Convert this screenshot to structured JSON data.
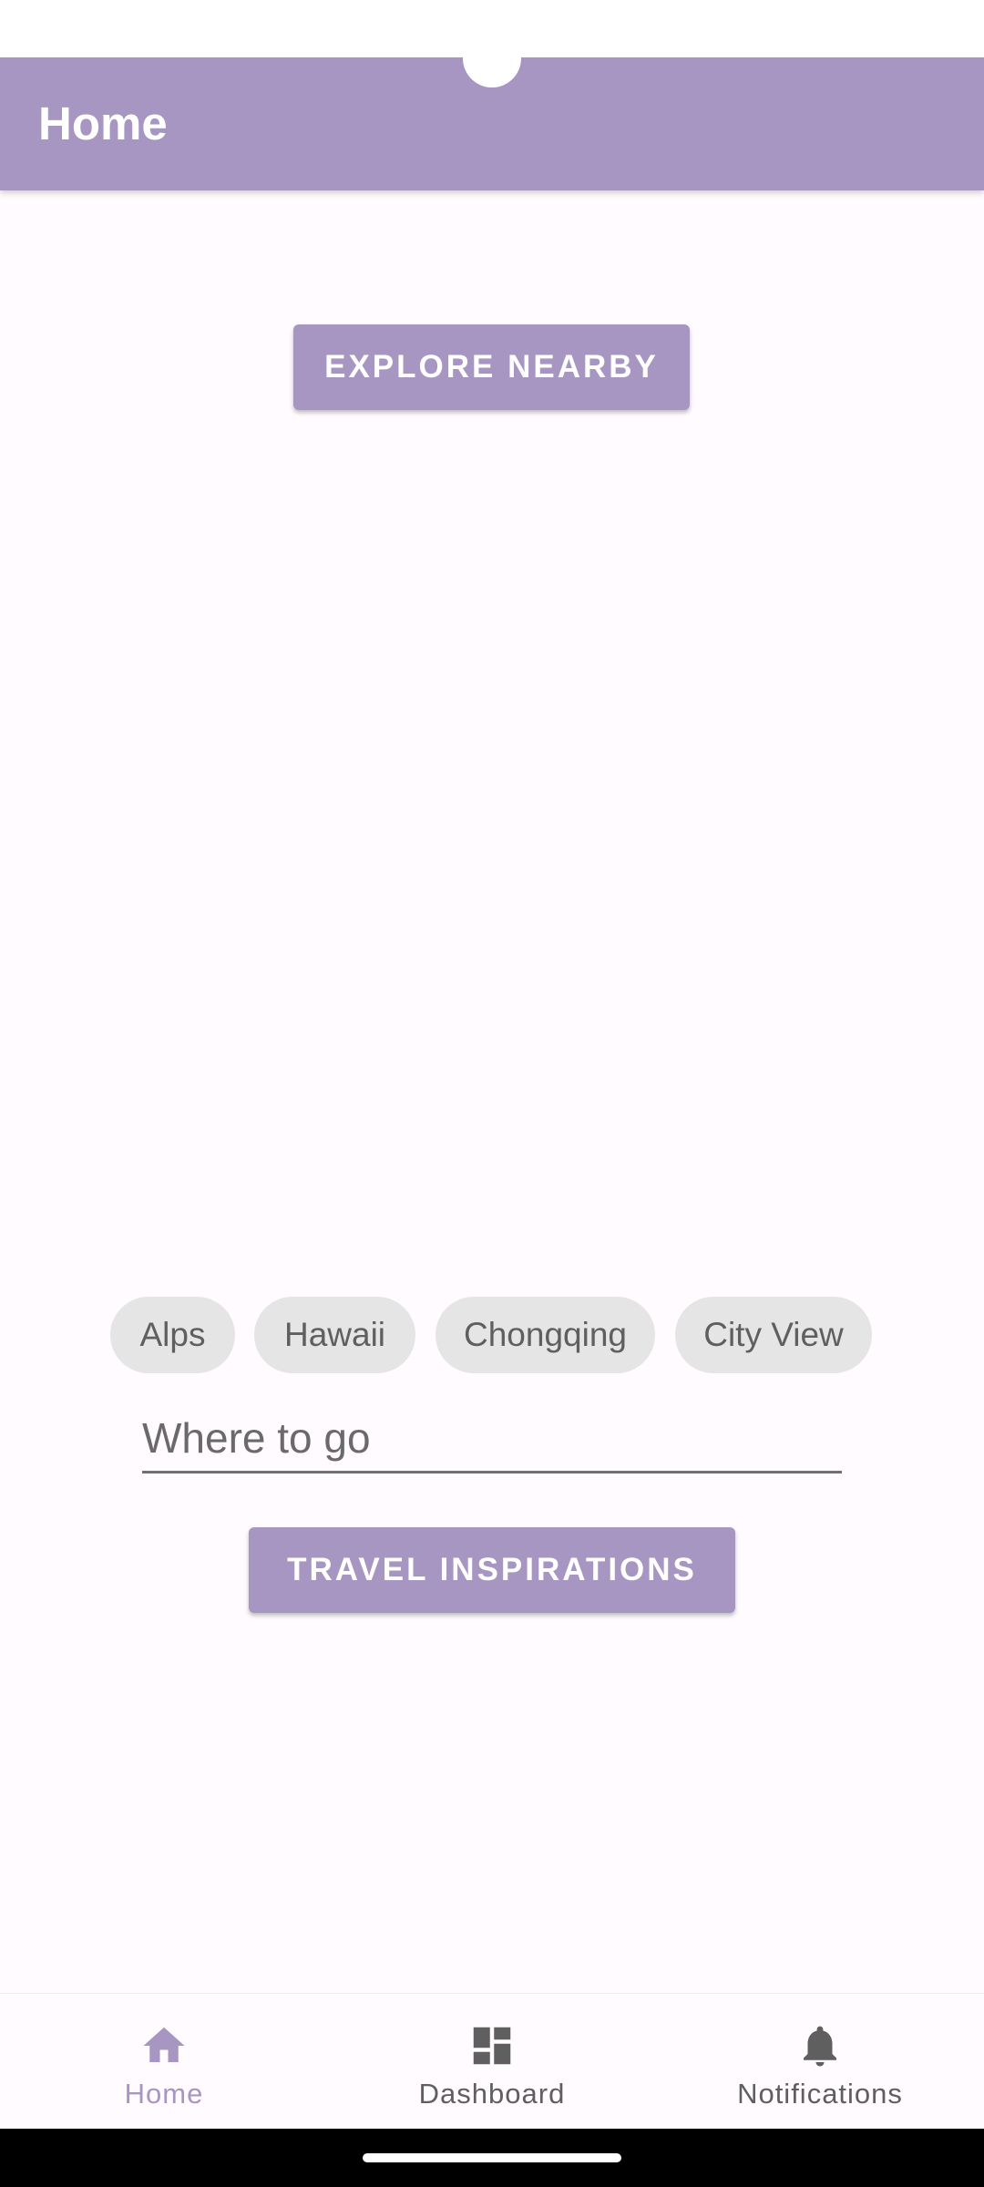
{
  "app_bar": {
    "title": "Home"
  },
  "main": {
    "explore_button_label": "EXPLORE NEARBY",
    "chips": [
      {
        "label": "Alps"
      },
      {
        "label": "Hawaii"
      },
      {
        "label": "Chongqing"
      },
      {
        "label": "City View"
      }
    ],
    "destination_input": {
      "placeholder": "Where to go",
      "value": ""
    },
    "travel_button_label": "TRAVEL INSPIRATIONS"
  },
  "bottom_nav": {
    "items": [
      {
        "label": "Home",
        "icon": "home-icon",
        "selected": true
      },
      {
        "label": "Dashboard",
        "icon": "dashboard-icon",
        "selected": false
      },
      {
        "label": "Notifications",
        "icon": "bell-icon",
        "selected": false
      }
    ]
  },
  "colors": {
    "primary": "#a896c2",
    "chip_background": "#e5e5e5",
    "inactive_nav": "#5f5f5f",
    "background": "#fffbfe"
  }
}
